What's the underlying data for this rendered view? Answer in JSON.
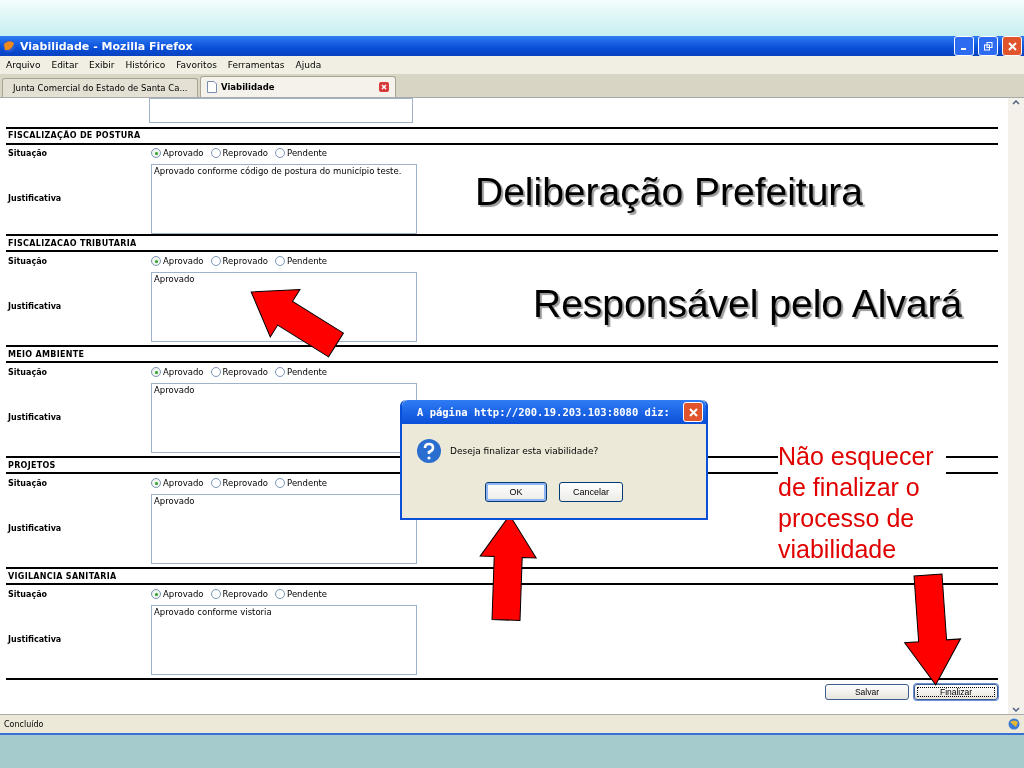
{
  "window": {
    "title": "Viabilidade - Mozilla Firefox"
  },
  "menu": [
    "Arquivo",
    "Editar",
    "Exibir",
    "Histórico",
    "Favoritos",
    "Ferramentas",
    "Ajuda"
  ],
  "tabs": [
    {
      "label": "Junta Comercial do Estado de Santa Ca...",
      "selected": false
    },
    {
      "label": "Viabilidade",
      "selected": true
    }
  ],
  "sections": [
    {
      "title": "FISCALIZAÇÃO DE POSTURA",
      "situation_label": "Situação",
      "options": [
        {
          "label": "Aprovado",
          "selected": true
        },
        {
          "label": "Reprovado",
          "selected": false
        },
        {
          "label": "Pendente",
          "selected": false
        }
      ],
      "justification_label": "Justificativa",
      "justification": "Aprovado conforme código de postura do município teste."
    },
    {
      "title": "FISCALIZACAO TRIBUTARIA",
      "situation_label": "Situação",
      "options": [
        {
          "label": "Aprovado",
          "selected": true
        },
        {
          "label": "Reprovado",
          "selected": false
        },
        {
          "label": "Pendente",
          "selected": false
        }
      ],
      "justification_label": "Justificativa",
      "justification": "Aprovado"
    },
    {
      "title": "MEIO AMBIENTE",
      "situation_label": "Situação",
      "options": [
        {
          "label": "Aprovado",
          "selected": true
        },
        {
          "label": "Reprovado",
          "selected": false
        },
        {
          "label": "Pendente",
          "selected": false
        }
      ],
      "justification_label": "Justificativa",
      "justification": "Aprovado"
    },
    {
      "title": "PROJETOS",
      "situation_label": "Situação",
      "options": [
        {
          "label": "Aprovado",
          "selected": true
        },
        {
          "label": "Reprovado",
          "selected": false
        },
        {
          "label": "Pendente",
          "selected": false
        }
      ],
      "justification_label": "Justificativa",
      "justification": "Aprovado"
    },
    {
      "title": "VIGILANCIA SANITARIA",
      "situation_label": "Situação",
      "options": [
        {
          "label": "Aprovado",
          "selected": true
        },
        {
          "label": "Reprovado",
          "selected": false
        },
        {
          "label": "Pendente",
          "selected": false
        }
      ],
      "justification_label": "Justificativa",
      "justification": "Aprovado conforme vistoria"
    }
  ],
  "buttons": [
    {
      "label": "Salvar",
      "focused": false
    },
    {
      "label": "Finalizar",
      "focused": true
    }
  ],
  "status_bar": "Concluído",
  "dialog": {
    "title": "A página http://200.19.203.103:8080 diz:",
    "message": "Deseja finalizar esta viabilidade?",
    "buttons": [
      {
        "label": "OK",
        "focused": true
      },
      {
        "label": "Cancelar",
        "focused": false
      }
    ]
  },
  "annotations": [
    {
      "kind": "heading",
      "text": "Deliberação Prefeitura"
    },
    {
      "kind": "heading",
      "text": "Responsável pelo Alvará"
    },
    {
      "kind": "note",
      "text": "Não esquecer de finalizar o processo de viabilidade"
    }
  ]
}
